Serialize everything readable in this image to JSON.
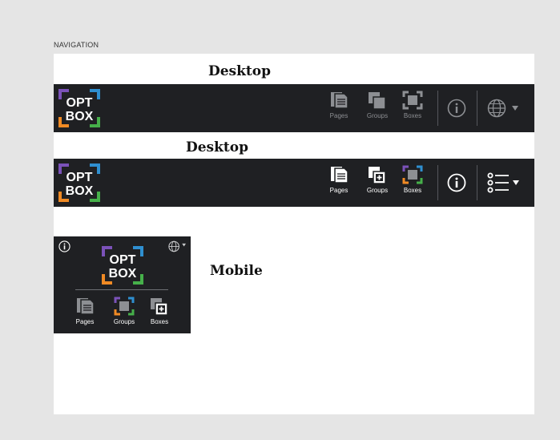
{
  "section_label": "NAVIGATION",
  "headings": {
    "first": "Desktop",
    "second": "Desktop",
    "mobile": "Mobile"
  },
  "logo": {
    "line1": "OPT",
    "line2": "BOX"
  },
  "nav": {
    "pages": "Pages",
    "groups": "Groups",
    "boxes": "Boxes"
  },
  "colors": {
    "bar": "#1f2023",
    "purple": "#7b52b9",
    "blue": "#2f8fd0",
    "orange": "#f08a24",
    "green": "#46b04a",
    "dim_icon": "#8d8f93"
  },
  "icons": [
    "info-icon",
    "globe-icon",
    "list-menu-icon",
    "chevron-down-icon",
    "pages-icon",
    "groups-icon",
    "boxes-icon"
  ]
}
